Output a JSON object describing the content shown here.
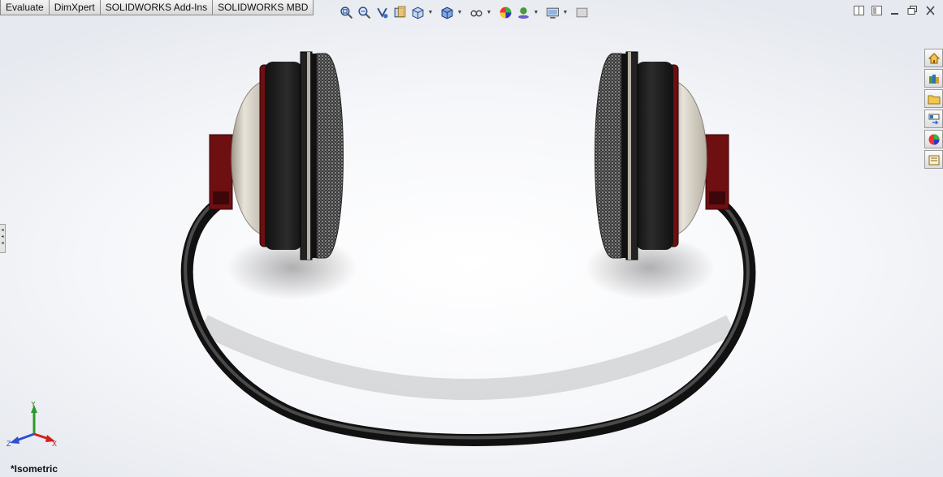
{
  "command_tabs": [
    {
      "id": "evaluate",
      "label": "Evaluate"
    },
    {
      "id": "dimxpert",
      "label": "DimXpert"
    },
    {
      "id": "addins",
      "label": "SOLIDWORKS Add-Ins"
    },
    {
      "id": "mbd",
      "label": "SOLIDWORKS MBD"
    }
  ],
  "heads_up_toolbar": [
    "zoom-to-fit-icon",
    "zoom-to-area-icon",
    "previous-view-icon",
    "section-view-icon",
    "view-orientation-icon",
    "display-style-icon",
    "hide-show-items-icon",
    "edit-appearance-icon",
    "apply-scene-icon",
    "view-settings-icon",
    "display-pane-icon"
  ],
  "task_pane": [
    "solidworks-resources-icon",
    "design-library-icon",
    "file-explorer-icon",
    "view-palette-icon",
    "appearances-scenes-icon",
    "custom-properties-icon"
  ],
  "triad": {
    "y_label": "Y",
    "x_label": "X",
    "z_label": "Z"
  },
  "view_label": "*Isometric",
  "colors": {
    "cup_red": "#6e0f12",
    "cup_black": "#1c1c1c",
    "shell_beige": "#cfc9bd",
    "band_black": "#222222",
    "axis_x": "#d21f1f",
    "axis_y": "#2a9a2a",
    "axis_z": "#2f4fd0"
  }
}
